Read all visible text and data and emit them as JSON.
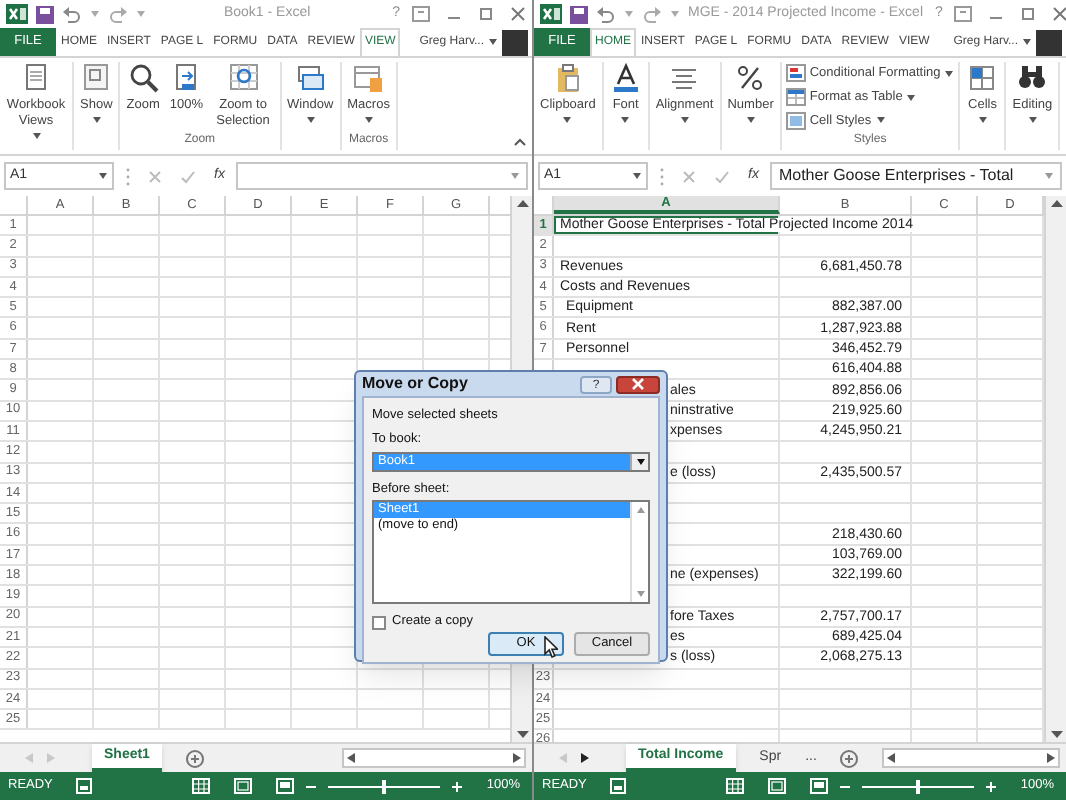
{
  "windows": [
    {
      "title": "Book1 - Excel",
      "help": "?",
      "user": "Greg Harv...",
      "tabs": [
        {
          "label": "FILE",
          "kind": "file",
          "selected": false
        },
        {
          "label": "HOME",
          "kind": "tab",
          "selected": false
        },
        {
          "label": "INSERT",
          "kind": "tab",
          "selected": false
        },
        {
          "label": "PAGE L",
          "kind": "tab",
          "selected": false
        },
        {
          "label": "FORMU",
          "kind": "tab",
          "selected": false
        },
        {
          "label": "DATA",
          "kind": "tab",
          "selected": false
        },
        {
          "label": "REVIEW",
          "kind": "tab",
          "selected": false
        },
        {
          "label": "VIEW",
          "kind": "tab",
          "selected": true
        }
      ],
      "ribbon": [
        {
          "buttons": [
            {
              "label": "Workbook Views",
              "kind": "views",
              "dropdown": true
            }
          ]
        },
        {
          "buttons": [
            {
              "label": "Show",
              "kind": "show",
              "dropdown": true
            }
          ]
        },
        {
          "label": "Zoom",
          "buttons": [
            {
              "label": "Zoom",
              "kind": "zoom",
              "dropdown": false
            },
            {
              "label": "100%",
              "kind": "zoom100",
              "dropdown": false
            },
            {
              "label": "Zoom to Selection",
              "kind": "zoomsel",
              "dropdown": false
            }
          ]
        },
        {
          "buttons": [
            {
              "label": "Window",
              "kind": "window",
              "dropdown": true
            }
          ]
        },
        {
          "label": "Macros",
          "buttons": [
            {
              "label": "Macros",
              "kind": "macros",
              "dropdown": true
            }
          ]
        }
      ],
      "name_box": "A1",
      "function_label": "fx",
      "columns": [
        {
          "label": "A",
          "selected": false
        },
        {
          "label": "B",
          "selected": false
        },
        {
          "label": "C",
          "selected": false
        },
        {
          "label": "D",
          "selected": false
        },
        {
          "label": "E",
          "selected": false
        },
        {
          "label": "F",
          "selected": false
        },
        {
          "label": "G",
          "selected": false
        }
      ],
      "rows": [
        {
          "label": "1",
          "selected": false
        },
        {
          "label": "2",
          "selected": false
        },
        {
          "label": "3",
          "selected": false
        },
        {
          "label": "4",
          "selected": false
        },
        {
          "label": "5",
          "selected": false
        },
        {
          "label": "6",
          "selected": false
        },
        {
          "label": "7",
          "selected": false
        },
        {
          "label": "8",
          "selected": false
        },
        {
          "label": "9",
          "selected": false
        },
        {
          "label": "10",
          "selected": false
        },
        {
          "label": "11",
          "selected": false
        },
        {
          "label": "12",
          "selected": false
        },
        {
          "label": "13",
          "selected": false
        },
        {
          "label": "14",
          "selected": false
        },
        {
          "label": "15",
          "selected": false
        },
        {
          "label": "16",
          "selected": false
        },
        {
          "label": "17",
          "selected": false
        },
        {
          "label": "18",
          "selected": false
        },
        {
          "label": "19",
          "selected": false
        },
        {
          "label": "20",
          "selected": false
        },
        {
          "label": "21",
          "selected": false
        },
        {
          "label": "22",
          "selected": false
        },
        {
          "label": "23",
          "selected": false
        },
        {
          "label": "24",
          "selected": false
        },
        {
          "label": "25",
          "selected": false
        }
      ],
      "sheet_nav": {
        "prev_enabled": false,
        "next_enabled": false
      },
      "sheets": [
        {
          "label": "Sheet1",
          "selected": true
        }
      ],
      "status": {
        "text": "READY",
        "zoom": "100%",
        "level": 0.5
      }
    },
    {
      "title": "MGE - 2014 Projected Income - Excel",
      "help": "?",
      "user": "Greg Harv...",
      "tabs": [
        {
          "label": "FILE",
          "kind": "file",
          "selected": false
        },
        {
          "label": "HOME",
          "kind": "tab",
          "selected": true
        },
        {
          "label": "INSERT",
          "kind": "tab",
          "selected": false
        },
        {
          "label": "PAGE L",
          "kind": "tab",
          "selected": false
        },
        {
          "label": "FORMU",
          "kind": "tab",
          "selected": false
        },
        {
          "label": "DATA",
          "kind": "tab",
          "selected": false
        },
        {
          "label": "REVIEW",
          "kind": "tab",
          "selected": false
        },
        {
          "label": "VIEW",
          "kind": "tab",
          "selected": false
        }
      ],
      "ribbon": [
        {
          "buttons": [
            {
              "label": "Clipboard",
              "kind": "clipboard",
              "dropdown": true
            }
          ]
        },
        {
          "buttons": [
            {
              "label": "Font",
              "kind": "font",
              "dropdown": true
            }
          ]
        },
        {
          "buttons": [
            {
              "label": "Alignment",
              "kind": "alignment",
              "dropdown": true
            }
          ]
        },
        {
          "buttons": [
            {
              "label": "Number",
              "kind": "number",
              "dropdown": true
            }
          ]
        },
        {
          "label": "Styles",
          "buttons": [
            {
              "label": "Conditional Formatting",
              "kind": "condformat",
              "dropdown": true
            },
            {
              "label": "Format as Table",
              "kind": "formattable",
              "dropdown": true
            },
            {
              "label": "Cell Styles",
              "kind": "cellstyles",
              "dropdown": true
            }
          ]
        },
        {
          "buttons": [
            {
              "label": "Cells",
              "kind": "cells",
              "dropdown": true
            }
          ]
        },
        {
          "buttons": [
            {
              "label": "Editing",
              "kind": "editing",
              "dropdown": true
            }
          ]
        }
      ],
      "name_box": "A1",
      "function_label": "fx",
      "formula": "Mother Goose Enterprises - Total",
      "columns": [
        {
          "label": "A",
          "selected": true
        },
        {
          "label": "B",
          "selected": false
        },
        {
          "label": "C",
          "selected": false
        },
        {
          "label": "D",
          "selected": false
        }
      ],
      "rows": [
        {
          "label": "1",
          "selected": true,
          "cells": [
            {
              "text": "Mother Goose Enterprises - Total Projected Income 2014",
              "kind": "text",
              "selected": true
            }
          ]
        },
        {
          "label": "2",
          "selected": false
        },
        {
          "label": "3",
          "selected": false,
          "cells": [
            {
              "text": "Revenues",
              "kind": "text",
              "selected": false
            },
            {
              "text": "6,681,450.78",
              "kind": "number",
              "selected": false
            }
          ]
        },
        {
          "label": "4",
          "selected": false,
          "cells": [
            {
              "text": "Costs and Revenues",
              "kind": "text",
              "selected": false
            }
          ]
        },
        {
          "label": "5",
          "selected": false,
          "cells": [
            {
              "text": "Equipment",
              "kind": "indent",
              "selected": false
            },
            {
              "text": "882,387.00",
              "kind": "number",
              "selected": false
            }
          ]
        },
        {
          "label": "6",
          "selected": false,
          "cells": [
            {
              "text": "Rent",
              "kind": "indent",
              "selected": false
            },
            {
              "text": "1,287,923.88",
              "kind": "number",
              "selected": false
            }
          ]
        },
        {
          "label": "7",
          "selected": false,
          "cells": [
            {
              "text": "Personnel",
              "kind": "indent",
              "selected": false
            },
            {
              "text": "346,452.79",
              "kind": "number",
              "selected": false
            }
          ]
        },
        {
          "selected": false,
          "cells": [
            null,
            {
              "text": "616,404.88",
              "kind": "number",
              "selected": false
            }
          ]
        },
        {
          "selected": false,
          "cells": [
            {
              "text": "ales",
              "kind": "partial",
              "selected": false
            },
            {
              "text": "892,856.06",
              "kind": "number",
              "selected": false
            }
          ]
        },
        {
          "selected": false,
          "cells": [
            {
              "text": "ninstrative",
              "kind": "partial",
              "selected": false
            },
            {
              "text": "219,925.60",
              "kind": "number",
              "selected": false
            }
          ]
        },
        {
          "selected": false,
          "cells": [
            {
              "text": "xpenses",
              "kind": "partial",
              "selected": false
            },
            {
              "text": "4,245,950.21",
              "kind": "number",
              "selected": false
            }
          ]
        },
        {
          "selected": false
        },
        {
          "selected": false,
          "cells": [
            {
              "text": "e (loss)",
              "kind": "partial",
              "selected": false
            },
            {
              "text": "2,435,500.57",
              "kind": "number",
              "selected": false
            }
          ]
        },
        {
          "selected": false
        },
        {
          "selected": false
        },
        {
          "selected": false,
          "cells": [
            null,
            {
              "text": "218,430.60",
              "kind": "number",
              "selected": false
            }
          ]
        },
        {
          "selected": false,
          "cells": [
            null,
            {
              "text": "103,769.00",
              "kind": "number",
              "selected": false
            }
          ]
        },
        {
          "selected": false,
          "cells": [
            {
              "text": "ne (expenses)",
              "kind": "partial",
              "selected": false
            },
            {
              "text": "322,199.60",
              "kind": "number",
              "selected": false
            }
          ]
        },
        {
          "selected": false
        },
        {
          "selected": false,
          "cells": [
            {
              "text": "fore Taxes",
              "kind": "partial",
              "selected": false
            },
            {
              "text": "2,757,700.17",
              "kind": "number",
              "selected": false
            }
          ]
        },
        {
          "selected": false,
          "cells": [
            {
              "text": "es",
              "kind": "partial",
              "selected": false
            },
            {
              "text": "689,425.04",
              "kind": "number",
              "selected": false
            }
          ]
        },
        {
          "selected": false,
          "cells": [
            {
              "text": "s (loss)",
              "kind": "partial",
              "selected": false
            },
            {
              "text": "2,068,275.13",
              "kind": "number",
              "selected": false
            }
          ]
        },
        {
          "label": "23",
          "selected": false
        },
        {
          "label": "24",
          "selected": false
        },
        {
          "label": "25",
          "selected": false
        },
        {
          "label": "26",
          "selected": false
        }
      ],
      "sheet_nav": {
        "prev_enabled": false,
        "next_enabled": true
      },
      "sheets": [
        {
          "label": "Total Income",
          "selected": true
        },
        {
          "label": "Spr",
          "selected": false
        }
      ],
      "more_sheets": "...",
      "status": {
        "text": "READY",
        "zoom": "100%",
        "level": 0.5
      }
    }
  ],
  "dialog": {
    "title": "Move or Copy",
    "help": "?",
    "prompt": "Move selected sheets",
    "to_book": {
      "label": "To book:",
      "value": "Book1",
      "highlighted": true
    },
    "before_sheet": {
      "label": "Before sheet:",
      "items": [
        {
          "label": "Sheet1",
          "selected": true
        },
        {
          "label": "(move to end)",
          "selected": false
        }
      ]
    },
    "create_copy": {
      "label": "Create a copy",
      "checked": false
    },
    "buttons": [
      {
        "label": "OK",
        "default": true
      },
      {
        "label": "Cancel",
        "default": false
      }
    ]
  }
}
